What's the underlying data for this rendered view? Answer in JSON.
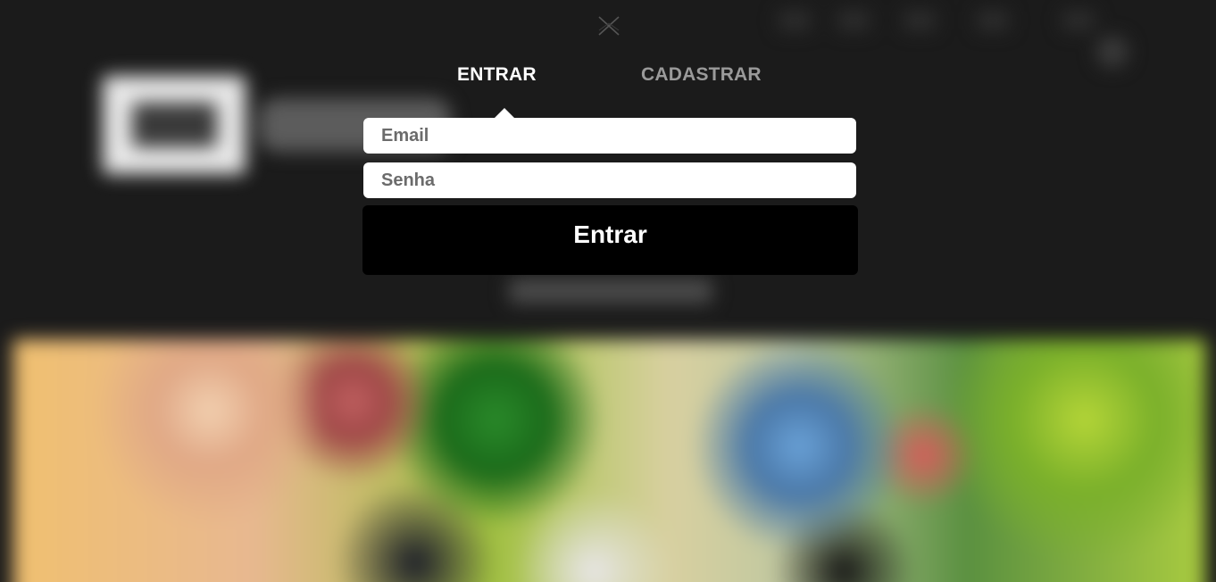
{
  "modal": {
    "tabs": [
      {
        "label": "ENTRAR",
        "active": true
      },
      {
        "label": "CADASTRAR",
        "active": false
      }
    ],
    "email": {
      "placeholder": "Email",
      "value": ""
    },
    "senha": {
      "placeholder": "Senha",
      "value": ""
    },
    "submit_label": "Entrar",
    "close_icon": "close-icon"
  },
  "colors": {
    "overlay_bg": "#1b1b1b",
    "tab_active": "#ffffff",
    "tab_inactive": "#9a9a9a",
    "button_bg": "#000000",
    "field_bg": "#ffffff"
  }
}
